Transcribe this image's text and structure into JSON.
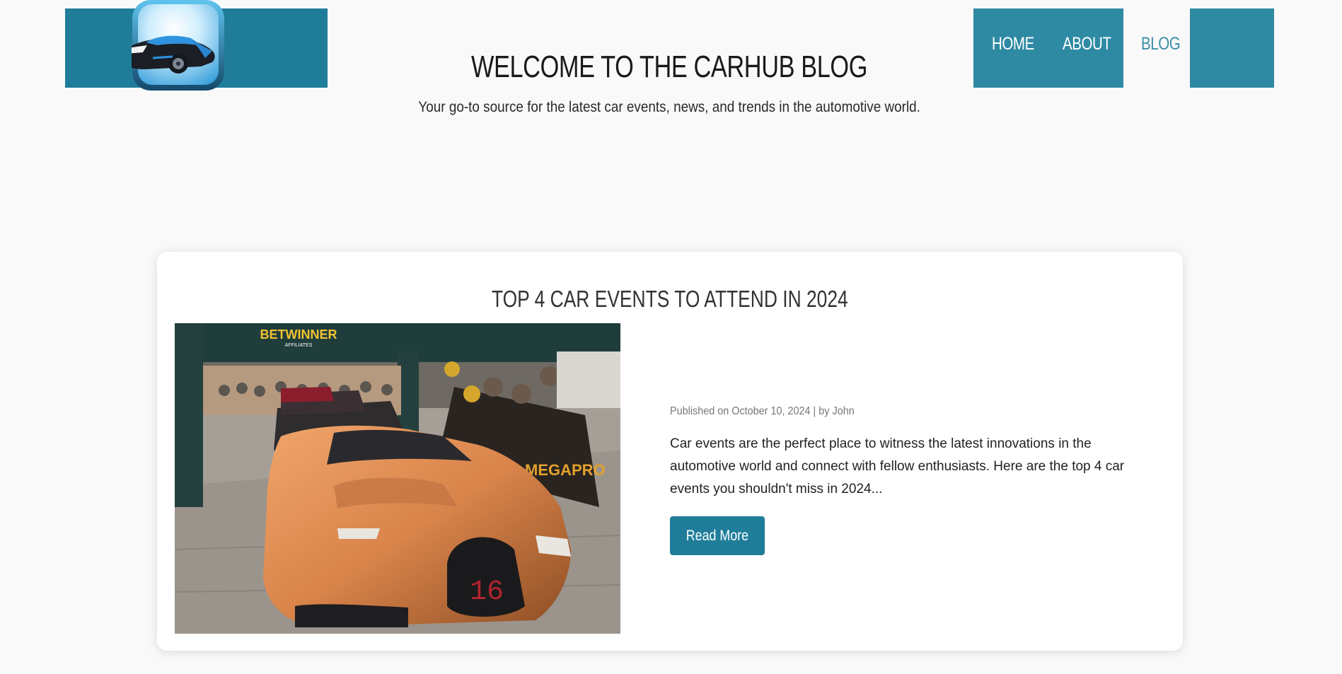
{
  "nav": {
    "home": "HOME",
    "about": "ABOUT",
    "blog": "BLOG"
  },
  "hero": {
    "title": "WELCOME TO THE CARHUB BLOG",
    "subtitle": "Your go-to source for the latest car events, news, and trends in the automotive world."
  },
  "post": {
    "title": "TOP 4 CAR EVENTS TO ATTEND IN 2024",
    "meta": "Published on October 10, 2024 | by John",
    "excerpt": "Car events are the perfect place to witness the latest innovations in the automotive world and connect with fellow enthusiasts. Here are the top 4 car events you shouldn't miss in 2024...",
    "read_more": "Read More",
    "image_signage": {
      "banner_brand": "BETWINNER",
      "banner_sub": "AFFILIATES",
      "plate_number": "16",
      "sponsor": "MEGAPRO"
    }
  },
  "colors": {
    "brand": "#1f7d9a",
    "nav_band": "#2e8aa3",
    "nav_active": "#3a8ea6"
  },
  "icons": {
    "logo": "car-app-icon"
  }
}
